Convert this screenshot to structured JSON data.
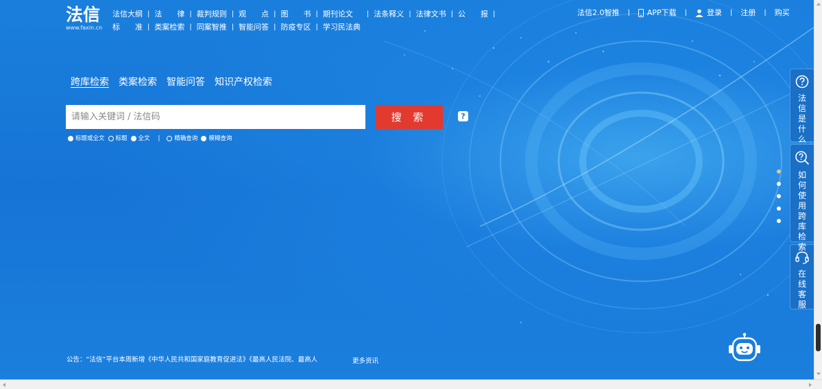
{
  "brand": {
    "logo_text": "法信",
    "logo_url": "www.faxin.cn"
  },
  "topnav": {
    "row1": [
      "法信大纲",
      "法　　律",
      "裁判规则",
      "观　　点",
      "图　　书",
      "期刊论文",
      "法条释义",
      "法律文书",
      "公　　报"
    ],
    "row2": [
      "标　　准",
      "类案检索",
      "同案智推",
      "智能问答",
      "防疫专区",
      "学习民法典"
    ]
  },
  "header_right": {
    "items": [
      "法信2.0智推",
      "APP下载",
      "登录",
      "注册",
      "购买"
    ]
  },
  "search": {
    "tabs": [
      "跨库检索",
      "类案检索",
      "智能问答",
      "知识产权检索"
    ],
    "active_tab": "跨库检索",
    "placeholder": "请输入关键词 / 法信码",
    "button_label": "搜 索",
    "help_label": "?",
    "scope_options": [
      {
        "label": "标题或全文",
        "selected": true
      },
      {
        "label": "标题",
        "selected": false
      },
      {
        "label": "全文",
        "selected": true
      }
    ],
    "separator": "|",
    "match_options": [
      {
        "label": "精确查询",
        "selected": false
      },
      {
        "label": "模糊查询",
        "selected": true
      }
    ]
  },
  "announcement": {
    "text": "公告：“法信”平台本周新增《中华人民共和国家庭教育促进法》《最高人民法院、最高人",
    "more_label": "更多资讯"
  },
  "side_panel": {
    "items": [
      {
        "label": "法信是什么",
        "icon": "question-circle-icon"
      },
      {
        "label": "如何使用跨库检索",
        "icon": "search-question-icon"
      },
      {
        "label": "在线客服",
        "icon": "headset-icon"
      }
    ]
  },
  "colors": {
    "background": "#1679d8",
    "search_button": "#e23a2f",
    "active_dot": "#d9c79a"
  }
}
